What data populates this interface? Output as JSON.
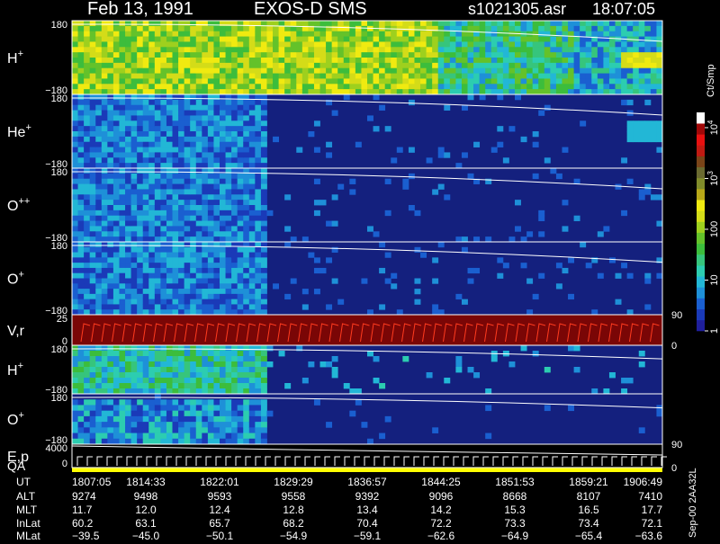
{
  "header": {
    "date": "Feb 13, 1991",
    "instrument": "EXOS-D SMS",
    "file": "s1021305.asr",
    "start_time": "18:07:05"
  },
  "side": {
    "units": "Ct/Smp",
    "version": "Sep-00 2AA32L"
  },
  "colorbar": {
    "tick_labels": [
      {
        "base": "10",
        "exp": "4"
      },
      {
        "base": "10",
        "exp": "3"
      },
      {
        "base": "100",
        "exp": ""
      },
      {
        "base": "10",
        "exp": ""
      },
      {
        "base": "1",
        "exp": ""
      }
    ],
    "tick_values": [
      10000,
      1000,
      100,
      10,
      1
    ],
    "colors": [
      "#1f1f9c",
      "#1a3ab8",
      "#1a5fd0",
      "#1e90d8",
      "#22b7d6",
      "#2ccdb0",
      "#36c57c",
      "#3cbd3c",
      "#64c22a",
      "#9ed01e",
      "#d4dc18",
      "#f0ea10",
      "#b8a818",
      "#808c2a",
      "#6a6a30",
      "#7a4418",
      "#c01a12",
      "#e81010",
      "#a00808",
      "#ffffff"
    ]
  },
  "colors": {
    "background": "#000000",
    "spectrogram_background": "#14207e",
    "velocity_background": "#7a0606",
    "velocity_trace": "#ff3b1f",
    "qa_bar": "#ffff00",
    "overlay_line": "#ffffff"
  },
  "chart_data": {
    "type": "heatmap",
    "panels": [
      {
        "name": "H",
        "sup": "+",
        "ymax": "180",
        "ymin": "−180",
        "right_label": "",
        "scheme": "green_high"
      },
      {
        "name": "He",
        "sup": "+",
        "ymax": "180",
        "ymin": "−180",
        "right_label": "",
        "scheme": "blue_mid"
      },
      {
        "name": "O",
        "sup": "++",
        "ymax": "180",
        "ymin": "−180",
        "right_label": "",
        "scheme": "blue_mid"
      },
      {
        "name": "O",
        "sup": "+",
        "ymax": "180",
        "ymin": "−180",
        "right_label": "90",
        "scheme": "blue_mid"
      },
      {
        "name": "V,r",
        "sup": "",
        "ymax": "25",
        "ymin": "0",
        "right_label": "0",
        "scheme": "velocity"
      },
      {
        "name": "H",
        "sup": "+",
        "ymax": "180",
        "ymin": "−180",
        "right_label": "",
        "scheme": "green_low"
      },
      {
        "name": "O",
        "sup": "+",
        "ymax": "180",
        "ymin": "−180",
        "right_label": "90",
        "scheme": "blue_patch"
      },
      {
        "name": "E,p",
        "sup": "",
        "ymax": "4000",
        "ymin": "0",
        "right_label": "0",
        "scheme": "energy"
      }
    ],
    "qa_label": "QA",
    "ephemeris_labels": [
      "UT",
      "ALT",
      "MLT",
      "InLat",
      "MLat"
    ],
    "ephemeris": [
      {
        "UT": "1807:05",
        "ALT": "9274",
        "MLT": "11.7",
        "InLat": "60.2",
        "MLat": "−39.5"
      },
      {
        "UT": "1814:33",
        "ALT": "9498",
        "MLT": "12.0",
        "InLat": "63.1",
        "MLat": "−45.0"
      },
      {
        "UT": "1822:01",
        "ALT": "9593",
        "MLT": "12.4",
        "InLat": "65.7",
        "MLat": "−50.1"
      },
      {
        "UT": "1829:29",
        "ALT": "9558",
        "MLT": "12.8",
        "InLat": "68.2",
        "MLat": "−54.9"
      },
      {
        "UT": "1836:57",
        "ALT": "9392",
        "MLT": "13.4",
        "InLat": "70.4",
        "MLat": "−59.1"
      },
      {
        "UT": "1844:25",
        "ALT": "9096",
        "MLT": "14.2",
        "InLat": "72.2",
        "MLat": "−62.6"
      },
      {
        "UT": "1851:53",
        "ALT": "8668",
        "MLT": "15.3",
        "InLat": "73.3",
        "MLat": "−64.9"
      },
      {
        "UT": "1859:21",
        "ALT": "8107",
        "MLT": "16.5",
        "InLat": "73.4",
        "MLat": "−65.4"
      },
      {
        "UT": "1906:49",
        "ALT": "7410",
        "MLT": "17.7",
        "InLat": "72.1",
        "MLat": "−63.6"
      }
    ]
  }
}
